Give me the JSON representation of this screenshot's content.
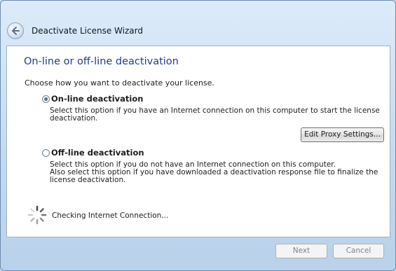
{
  "window": {
    "title": "Deactivate License Wizard"
  },
  "page": {
    "heading": "On-line or off-line deactivation",
    "intro": "Choose how you want to deactivate your license."
  },
  "options": {
    "online": {
      "label": "On-line deactivation",
      "selected": true,
      "description": [
        "Select this option if you have an Internet connection on this computer to start the license",
        "deactivation."
      ]
    },
    "offline": {
      "label": "Off-line deactivation",
      "selected": false,
      "description": [
        "Select this option if you do not have an Internet connection on this computer.",
        "Also select this option if you have downloaded a deactivation response file to finalize the",
        "license deactivation."
      ]
    }
  },
  "buttons": {
    "proxy": "Edit Proxy Settings...",
    "next": "Next",
    "cancel": "Cancel"
  },
  "status": {
    "text": "Checking Internet Connection..."
  },
  "icons": {
    "back": "back-arrow-icon",
    "spinner": "loading-spinner-icon"
  }
}
